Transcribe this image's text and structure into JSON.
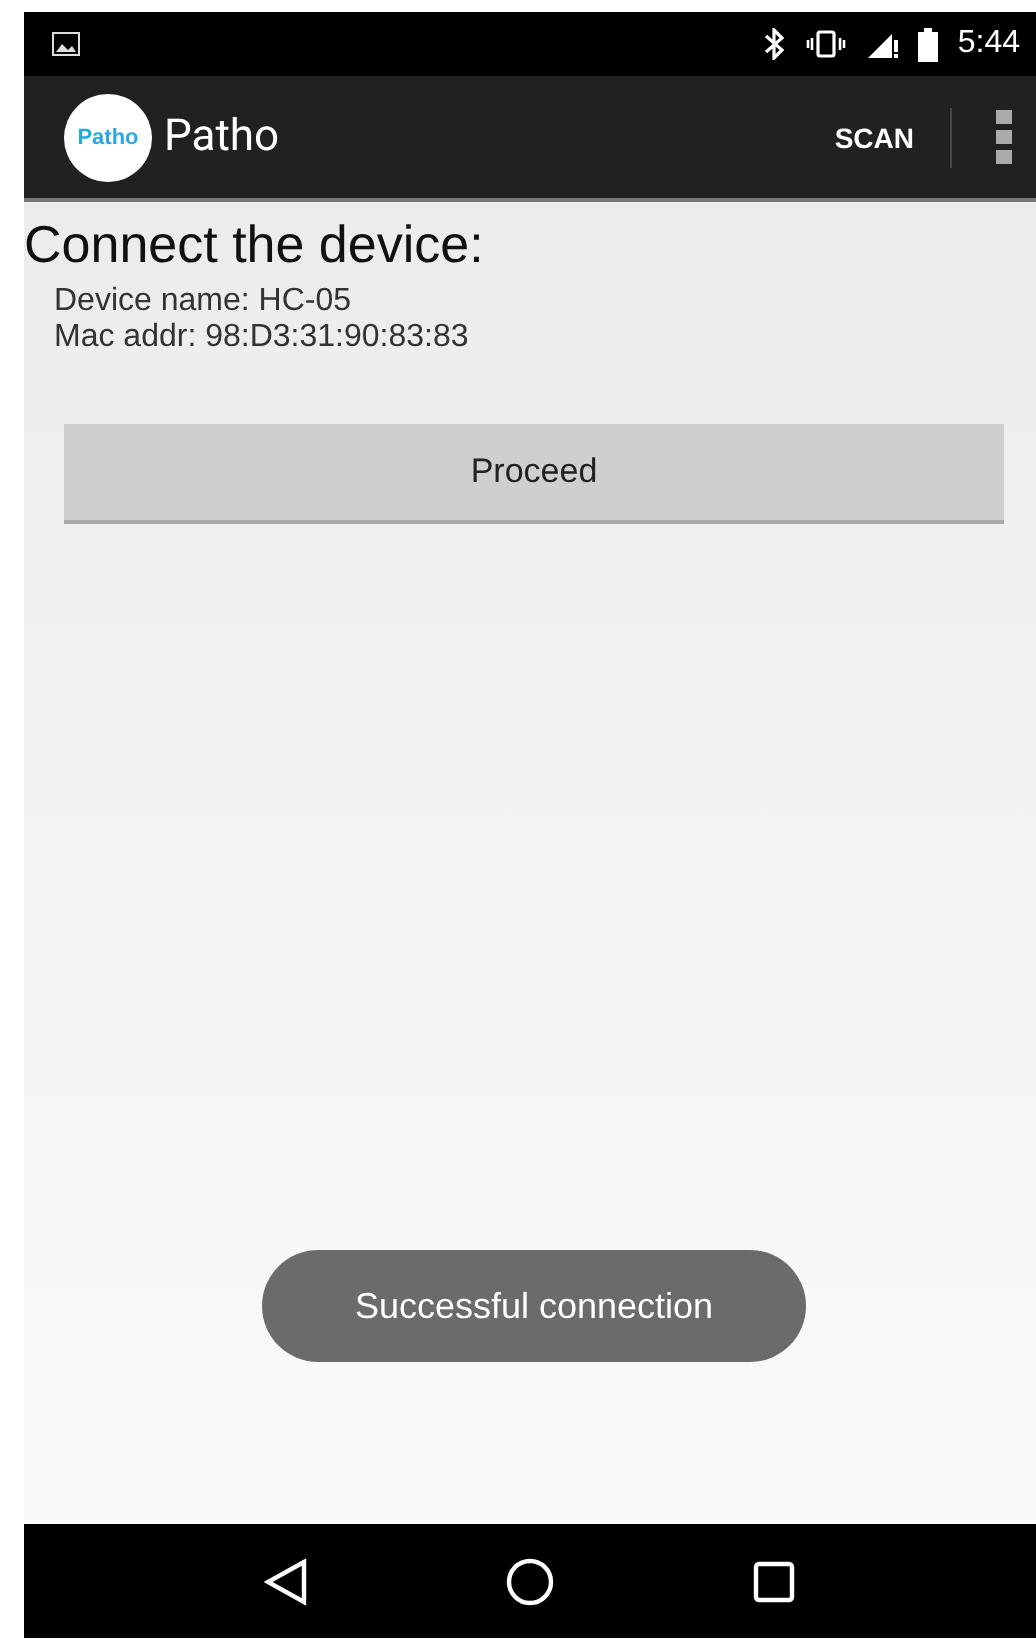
{
  "status_bar": {
    "time": "5:44"
  },
  "app_bar": {
    "logo_text": "Patho",
    "title": "Patho",
    "action": "SCAN"
  },
  "content": {
    "heading": "Connect the device:",
    "lines": [
      "Device name: HC-05",
      "Mac addr: 98:D3:31:90:83:83"
    ],
    "button": "Proceed"
  },
  "toast": {
    "text": "Successful connection"
  }
}
